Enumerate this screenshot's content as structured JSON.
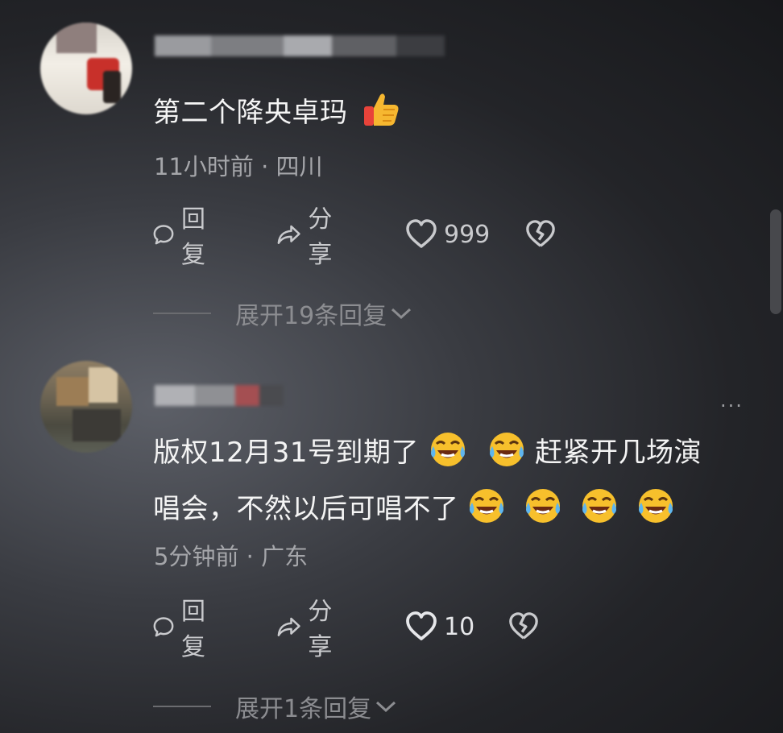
{
  "comments": [
    {
      "text": "第二个降央卓玛",
      "meta": "11小时前 · 四川",
      "actions": {
        "reply": "回复",
        "share": "分享",
        "likes": "999"
      },
      "expand": "展开19条回复"
    },
    {
      "text_line1": "版权12月31号到期了",
      "text_line1b": "赶紧开几场演",
      "text_line2": "唱会，不然以后可唱不了",
      "meta": "5分钟前 · 广东",
      "actions": {
        "reply": "回复",
        "share": "分享",
        "likes": "10"
      },
      "expand": "展开1条回复",
      "more": "···"
    }
  ],
  "icons": {
    "thumbs_up_emoji": "thumbs-up-emoji",
    "laugh_cry_emoji": "face-with-tears-of-joy-emoji",
    "reply": "speech-bubble-icon",
    "share": "share-arrow-icon",
    "like": "heart-icon",
    "dislike": "broken-heart-icon"
  },
  "colors": {
    "text": "#f4f4f4",
    "meta": "#a5a6aa",
    "action": "#c9cacd",
    "expand": "#8c8d91"
  }
}
